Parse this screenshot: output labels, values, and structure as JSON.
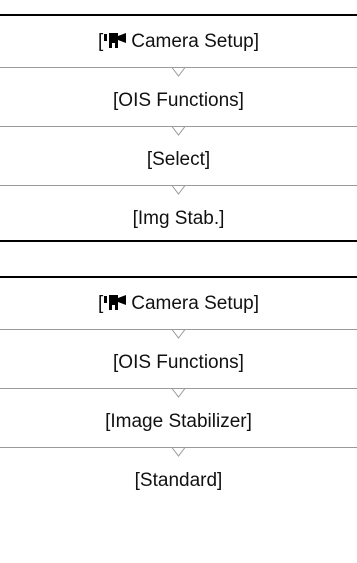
{
  "menu_paths": [
    {
      "steps": [
        {
          "text": "Camera Setup]",
          "open": "[",
          "icon": "camera-icon"
        },
        {
          "text": "[OIS Functions]"
        },
        {
          "text": "[Select]"
        },
        {
          "text": "[Img Stab.]"
        }
      ]
    },
    {
      "steps": [
        {
          "text": "Camera Setup]",
          "open": "[",
          "icon": "camera-icon"
        },
        {
          "text": "[OIS Functions]"
        },
        {
          "text": "[Image Stabilizer]"
        },
        {
          "text": "[Standard]"
        }
      ]
    }
  ]
}
